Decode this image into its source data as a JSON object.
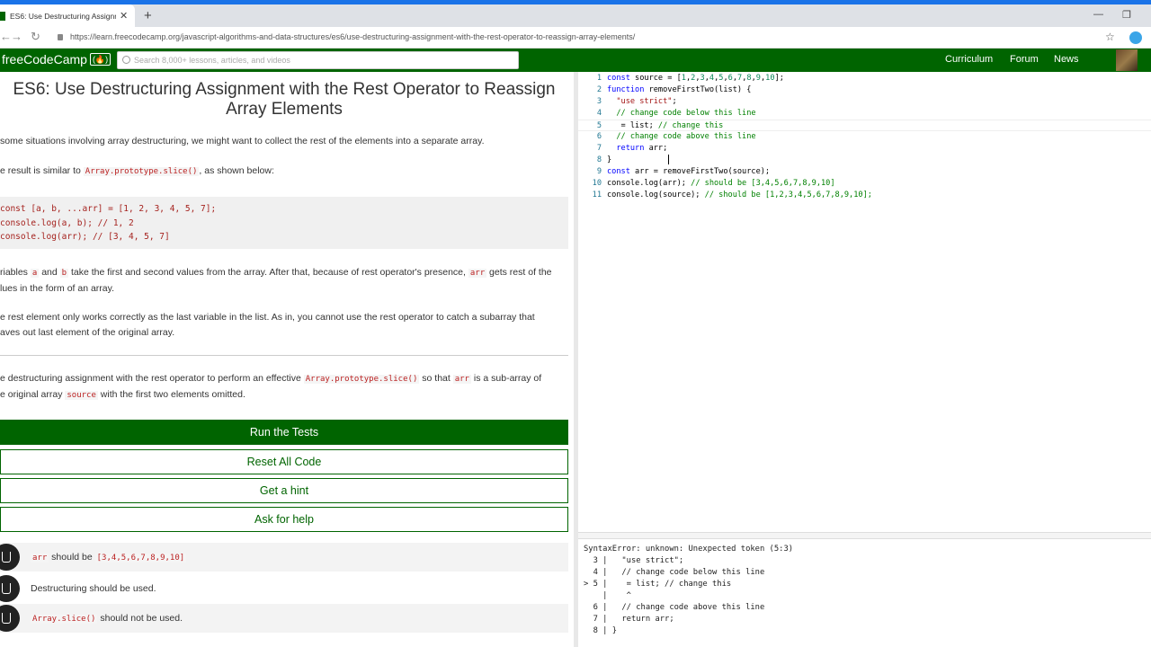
{
  "browser": {
    "tab_title": "ES6: Use Destructuring Assignme",
    "tab_close": "✕",
    "new_tab": "+",
    "url": "https://learn.freecodecamp.org/javascript-algorithms-and-data-structures/es6/use-destructuring-assignment-with-the-rest-operator-to-reassign-array-elements/"
  },
  "navbar": {
    "logo": "freeCodeCamp",
    "logo_fire": "(🔥)",
    "search_placeholder": "Search 8,000+ lessons, articles, and videos",
    "links": [
      "Curriculum",
      "Forum",
      "News"
    ]
  },
  "challenge": {
    "title": "ES6: Use Destructuring Assignment with the Rest Operator to Reassign Array Elements",
    "p1": "some situations involving array destructuring, we might want to collect the rest of the elements into a separate array.",
    "p2_pre": "e result is similar to ",
    "p2_code": "Array.prototype.slice()",
    "p2_post": ", as shown below:",
    "code_lines": [
      "const [a, b, ...arr] = [1, 2, 3, 4, 5, 7];",
      "console.log(a, b); // 1, 2",
      "console.log(arr); // [3, 4, 5, 7]"
    ],
    "p3_a": "riables ",
    "p3_code_a": "a",
    "p3_b": " and ",
    "p3_code_b": "b",
    "p3_c": " take the first and second values from the array. After that, because of rest operator's presence, ",
    "p3_code_c": "arr",
    "p3_d": " gets rest of the",
    "p3_line2": "lues in the form of an array.",
    "p4_line1": "e rest element only works correctly as the last variable in the list. As in, you cannot use the rest operator to catch a subarray that",
    "p4_line2": "aves out last element of the original array.",
    "p5_a": "e destructuring assignment with the rest operator to perform an effective ",
    "p5_code_a": "Array.prototype.slice()",
    "p5_b": " so that ",
    "p5_code_b": "arr",
    "p5_c": " is a sub-array of",
    "p5_line2_a": "e original array ",
    "p5_code_c": "source",
    "p5_line2_b": " with the first two elements omitted."
  },
  "buttons": {
    "run": "Run the Tests",
    "reset": "Reset All Code",
    "hint": "Get a hint",
    "help": "Ask for help"
  },
  "tests": [
    {
      "code": "arr",
      "text": " should be ",
      "code2": "[3,4,5,6,7,8,9,10]"
    },
    {
      "text": "Destructuring should be used."
    },
    {
      "code": "Array.slice()",
      "text": " should not be used."
    }
  ],
  "editor": {
    "line_numbers": [
      "1",
      "2",
      "3",
      "4",
      "5",
      "6",
      "7",
      "8",
      "9",
      "10",
      "11"
    ]
  },
  "console": {
    "error": "SyntaxError: unknown: Unexpected token (5:3)",
    "lines": [
      "  3 |   \"use strict\";",
      "  4 |   // change code below this line",
      "> 5 |    = list; // change this",
      "    |    ^",
      "  6 |   // change code above this line",
      "  7 |   return arr;",
      "  8 | }"
    ]
  }
}
